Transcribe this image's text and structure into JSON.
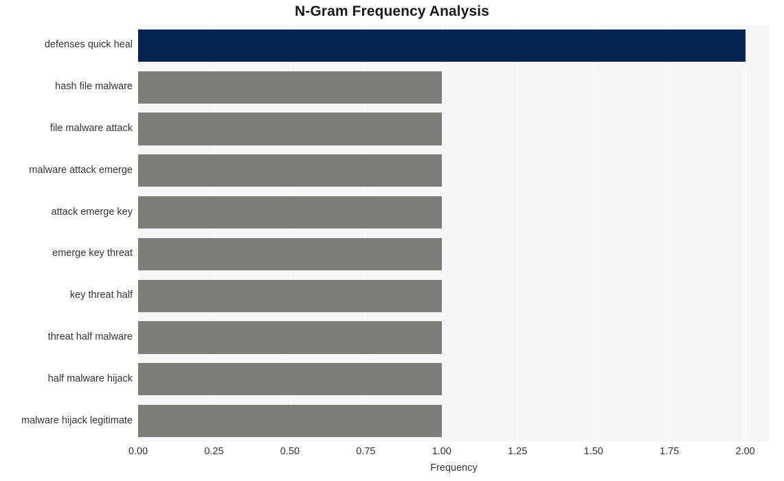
{
  "chart_data": {
    "type": "bar",
    "orientation": "horizontal",
    "title": "N-Gram Frequency Analysis",
    "xlabel": "Frequency",
    "ylabel": "",
    "xlim": [
      0,
      2.08
    ],
    "xticks": [
      0,
      0.25,
      0.5,
      0.75,
      1,
      1.25,
      1.5,
      1.75,
      2
    ],
    "xticklabels": [
      "0.00",
      "0.25",
      "0.50",
      "0.75",
      "1.00",
      "1.25",
      "1.50",
      "1.75",
      "2.00"
    ],
    "grid": true,
    "grid_axis": "x",
    "legend": false,
    "categories": [
      "defenses quick heal",
      "hash file malware",
      "file malware attack",
      "malware attack emerge",
      "attack emerge key",
      "emerge key threat",
      "key threat half",
      "threat half malware",
      "half malware hijack",
      "malware hijack legitimate"
    ],
    "values": [
      2,
      1,
      1,
      1,
      1,
      1,
      1,
      1,
      1,
      1
    ],
    "bar_colors": [
      "#042552",
      "#7d7d7a",
      "#7d7d7a",
      "#7d7d7a",
      "#7d7d7a",
      "#7d7d7a",
      "#7d7d7a",
      "#7d7d7a",
      "#7d7d7a",
      "#7d7d7a"
    ]
  },
  "style": {
    "figure_background": "#ffffff",
    "plot_background": "#f7f7f7",
    "gridline_color": "#ffffff",
    "title_color": "#1a1a1a",
    "tick_label_color": "#333333",
    "highlight_color": "#042552",
    "default_bar_color": "#7d7d7a"
  }
}
